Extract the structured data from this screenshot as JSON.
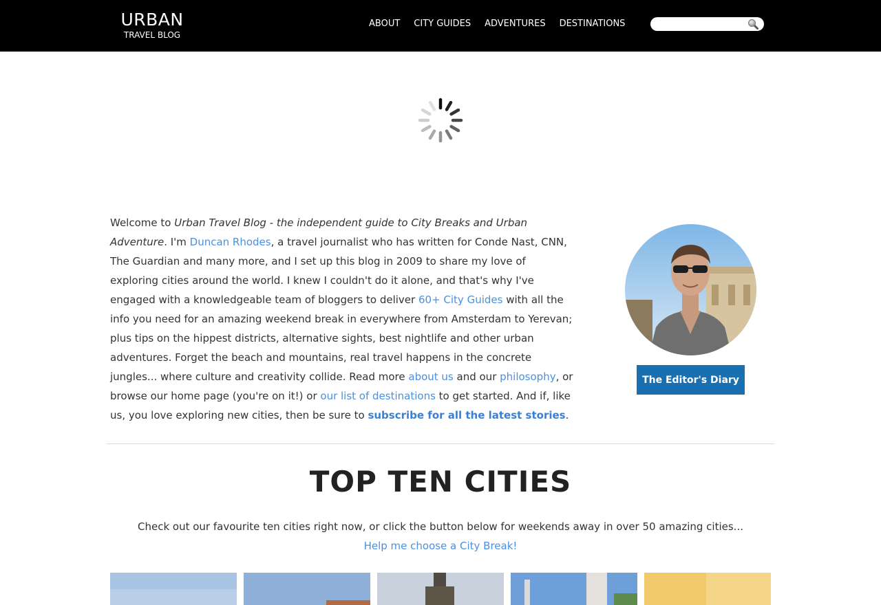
{
  "header": {
    "logo_main": "URBAN",
    "logo_sub": "TRAVEL BLOG",
    "nav": [
      "ABOUT",
      "CITY GUIDES",
      "ADVENTURES",
      "DESTINATIONS"
    ],
    "search_placeholder": ""
  },
  "intro": {
    "t1": "Welcome to ",
    "em": "Urban Travel Blog - the independent guide to City Breaks and Urban Adventure",
    "t2": ". I'm ",
    "link_author": "Duncan Rhodes",
    "t3": ", a travel journalist who has written for Conde Nast, CNN, The Guardian and many more, and I set up this blog in 2009 to share my love of exploring cities around the world. I knew I couldn't do it alone, and that's why I've engaged with a knowledgeable team of bloggers to deliver ",
    "link_guides": "60+ City Guides",
    "t4": " with all the info you need for an amazing weekend break in everywhere from Amsterdam to Yerevan; plus tips on the hippest districts, alternative sights, best nightlife and other urban adventures. Forget the beach and mountains, real travel happens in the concrete jungles... where culture and creativity collide. Read more ",
    "link_about": "about us",
    "t5": " and our ",
    "link_philosophy": "philosophy",
    "t6": ", or browse our home page (you're on it!) or ",
    "link_destinations": "our list of destinations",
    "t7": " to get started. And if, like us, you love exploring new cities, then be sure to ",
    "link_subscribe": "subscribe for all the latest stories",
    "t8": "."
  },
  "sidebar": {
    "diary_button": "The Editor's Diary"
  },
  "top_ten": {
    "title": "TOP TEN CITIES",
    "text": "Check out our favourite ten cities right now, or click the button below for weekends away in over 50 amazing cities...",
    "link": "Help me choose a City Break!"
  },
  "colors": {
    "header_bg": "#000000",
    "link": "#4a90e2",
    "button_bg": "#1a6fb0"
  }
}
